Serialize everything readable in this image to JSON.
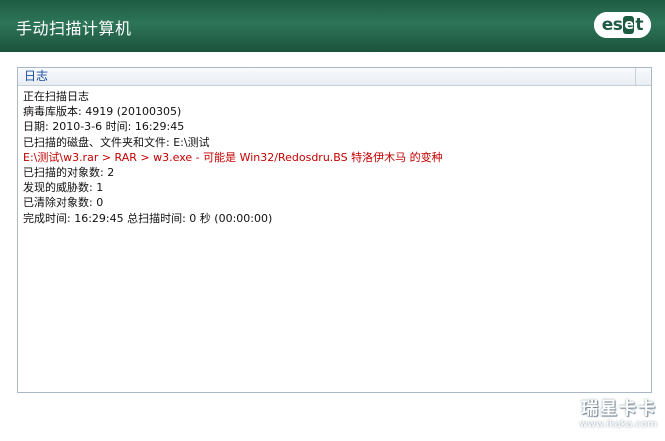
{
  "window": {
    "title": "手动扫描计算机",
    "brand": {
      "left": "es",
      "mid": "e",
      "right": "t"
    }
  },
  "log": {
    "header": "日志",
    "lines": [
      {
        "text": "正在扫描日志",
        "color": "#111111"
      },
      {
        "text": "病毒库版本: 4919 (20100305)",
        "color": "#111111"
      },
      {
        "text": "日期: 2010-3-6  时间: 16:29:45",
        "color": "#111111"
      },
      {
        "text": "已扫描的磁盘、文件夹和文件: E:\\测试",
        "color": "#111111"
      },
      {
        "text": "E:\\测试\\w3.rar > RAR > w3.exe - 可能是 Win32/Redosdru.BS 特洛伊木马 的变种",
        "color": "#c40000"
      },
      {
        "text": "已扫描的对象数: 2",
        "color": "#111111"
      },
      {
        "text": "发现的威胁数: 1",
        "color": "#111111"
      },
      {
        "text": "已清除对象数: 0",
        "color": "#111111"
      },
      {
        "text": "完成时间: 16:29:45  总扫描时间: 0 秒 (00:00:00)",
        "color": "#111111"
      }
    ]
  },
  "watermark": {
    "main": "瑞星卡卡",
    "sub": "www.ikaka.com"
  },
  "colors": {
    "titlebar": "#2a6e54",
    "warning_text": "#c40000",
    "header_text": "#1a4fa0"
  }
}
